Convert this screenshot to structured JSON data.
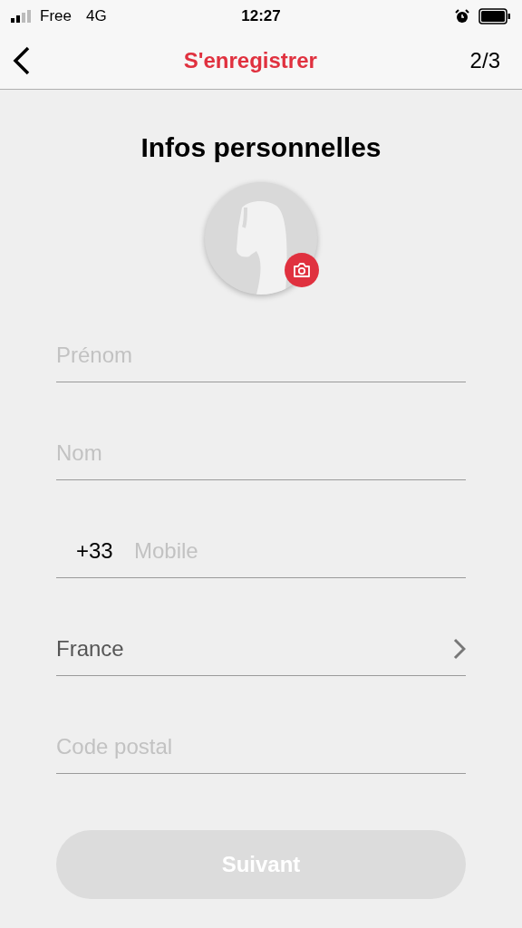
{
  "status_bar": {
    "carrier": "Free",
    "network": "4G",
    "time": "12:27"
  },
  "nav_bar": {
    "title": "S'enregistrer",
    "step": "2/3"
  },
  "heading": "Infos personnelles",
  "fields": [
    {
      "kind": "text",
      "placeholder": "Prénom"
    },
    {
      "kind": "text",
      "placeholder": "Nom"
    },
    {
      "kind": "phone",
      "prefix": "+33",
      "placeholder": "Mobile"
    },
    {
      "kind": "select",
      "value": "France"
    },
    {
      "kind": "text",
      "placeholder": "Code postal"
    }
  ],
  "button": {
    "label": "Suivant",
    "disabled": true
  }
}
